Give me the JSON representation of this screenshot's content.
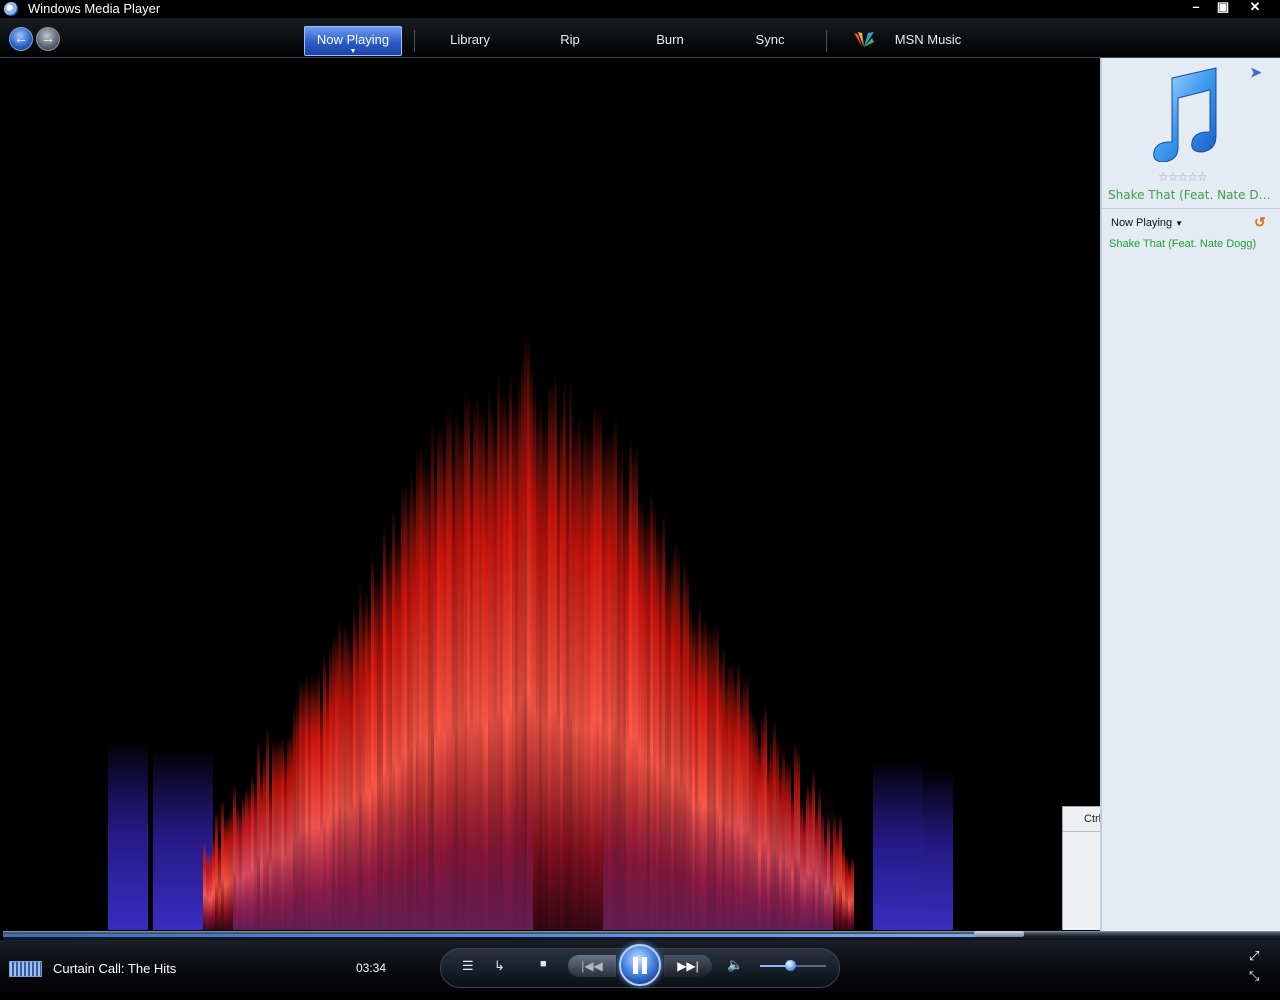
{
  "window": {
    "title": "Windows Media Player",
    "controls": {
      "minimize": "–",
      "restore": "▣",
      "close": "✕"
    }
  },
  "taskbar": {
    "back_icon": "back-arrow-icon",
    "forward_icon": "forward-arrow-icon",
    "tabs": [
      {
        "id": "now-playing",
        "label": "Now Playing",
        "active": true
      },
      {
        "id": "library",
        "label": "Library"
      },
      {
        "id": "rip",
        "label": "Rip"
      },
      {
        "id": "burn",
        "label": "Burn"
      },
      {
        "id": "sync",
        "label": "Sync"
      },
      {
        "id": "msn-music",
        "label": "MSN Music"
      }
    ],
    "active_tab_color": "#2c5cc8"
  },
  "visualization": {
    "popup_text": "Ctrl·"
  },
  "list_pane": {
    "album_title": "Shake That (Feat. Nate Do...",
    "rating": "☆☆☆☆☆",
    "playlist_selector": "Now Playing",
    "tracks": [
      {
        "title": "Shake That (Feat. Nate Dogg)",
        "color": "#20a030"
      }
    ],
    "accent_green": "#3fa04a"
  },
  "playback": {
    "status": "Curtain Call: The Hits",
    "time": "03:34",
    "seek_progress": 0.78,
    "volume": 0.45,
    "icons": {
      "menu": "☰",
      "shuffle": "↳",
      "stop": "■",
      "prev": "|◀◀",
      "next": "▶▶|",
      "volume": "🔈",
      "fullscreen": "⤢",
      "compact": "⤡"
    }
  }
}
